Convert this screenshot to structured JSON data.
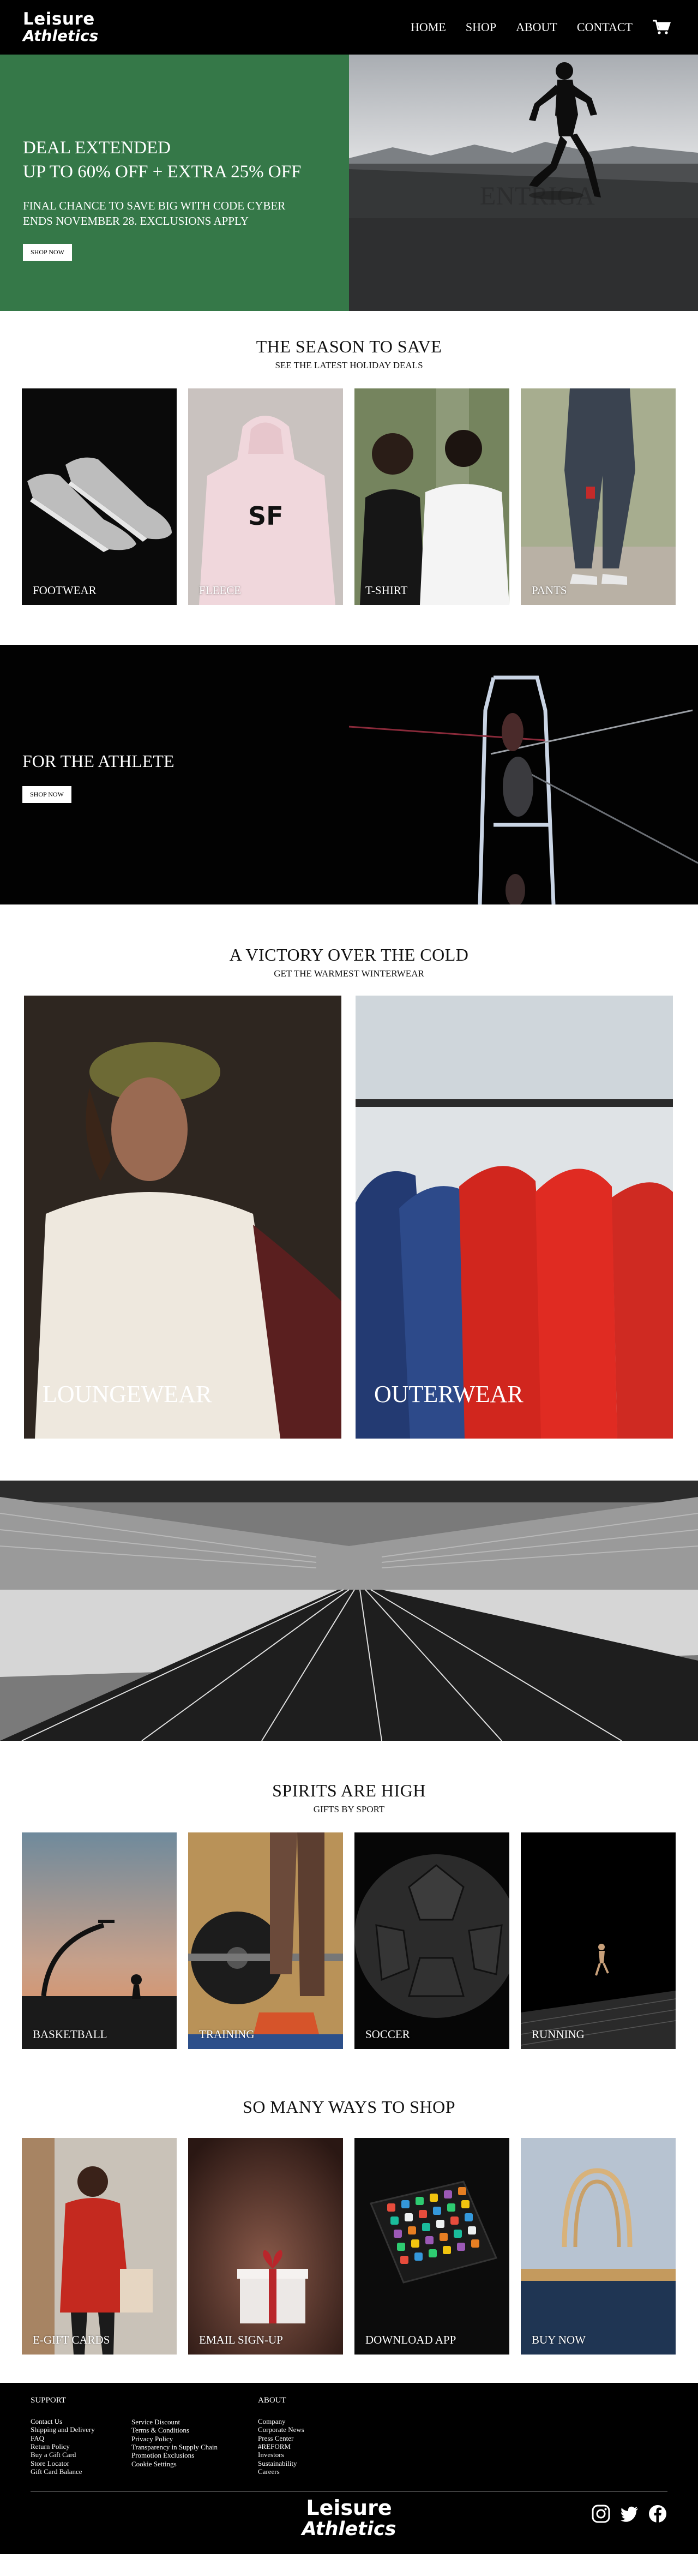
{
  "header": {
    "logo_line1": "Leisure",
    "logo_line2": "Athletics",
    "nav": [
      "HOME",
      "SHOP",
      "ABOUT",
      "CONTACT"
    ]
  },
  "hero": {
    "title_line1": "DEAL EXTENDED",
    "title_line2": "UP TO 60% OFF + EXTRA 25% OFF",
    "sub_line1": "FINAL CHANCE TO SAVE BIG WITH CODE CYBER",
    "sub_line2": "ENDS NOVEMBER 28. EXCLUSIONS APPLY",
    "button": "SHOP NOW",
    "wall_text": "ENTRIGA"
  },
  "season": {
    "title": "THE SEASON TO SAVE",
    "subtitle": "SEE THE LATEST HOLIDAY DEALS",
    "tiles": [
      "FOOTWEAR",
      "FLEECE",
      "T-SHIRT",
      "PANTS"
    ],
    "hoodie_print": "SF"
  },
  "athlete": {
    "title": "FOR THE ATHLETE",
    "button": "SHOP NOW"
  },
  "cold": {
    "title": "A VICTORY OVER THE COLD",
    "subtitle": "GET THE WARMEST WINTERWEAR",
    "tiles": [
      "LOUNGEWEAR",
      "OUTERWEAR"
    ]
  },
  "spirits": {
    "title": "SPIRITS ARE HIGH",
    "subtitle": "GIFTS BY SPORT",
    "tiles": [
      "BASKETBALL",
      "TRAINING",
      "SOCCER",
      "RUNNING"
    ]
  },
  "ways": {
    "title": "SO MANY WAYS TO SHOP",
    "tiles": [
      "E-GIFT CARDS",
      "EMAIL SIGN-UP",
      "DOWNLOAD APP",
      "BUY NOW"
    ]
  },
  "footer": {
    "support_heading": "SUPPORT",
    "support_col1": [
      "Contact Us",
      "Shipping and Delivery",
      "FAQ",
      "Return Policy",
      "Buy a Gift Card",
      "Store Locator",
      "Gift Card Balance"
    ],
    "support_col2": [
      "Service Discount",
      "Terms & Conditions",
      "Privacy Policy",
      "Transparency in Supply Chain",
      "Promotion Exclusions",
      "Cookie Settings"
    ],
    "about_heading": "ABOUT",
    "about_col": [
      "Company",
      "Corporate News",
      "Press Center",
      "#REFORM",
      "Investors",
      "Sustainability",
      "Careers"
    ],
    "logo_line1": "Leisure",
    "logo_line2": "Athletics",
    "social": [
      "instagram-icon",
      "twitter-icon",
      "facebook-icon"
    ]
  }
}
